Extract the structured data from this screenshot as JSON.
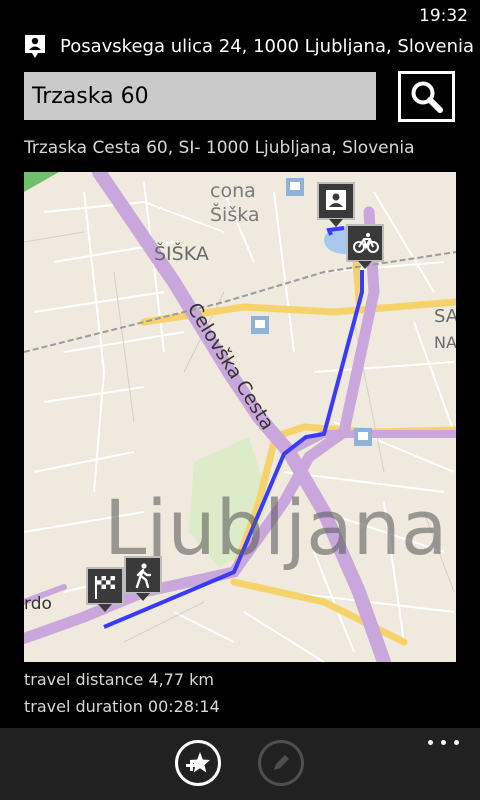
{
  "status_bar": {
    "time": "19:32"
  },
  "location": {
    "icon": "person-pin-icon",
    "text": "Posavskega ulica 24, 1000 Ljubljana, Slovenia"
  },
  "search": {
    "value": "Trzaska 60",
    "button_icon": "search-icon"
  },
  "result": {
    "address": "Trzaska Cesta 60, SI- 1000 Ljubljana, Slovenia"
  },
  "map": {
    "labels": {
      "district_cona_line1": "cona",
      "district_cona_line2": "Šiška",
      "district_siska": "ŠIŠKA",
      "street_celovska": "Celovška Cesta",
      "city": "Ljubljana",
      "edge_right_1": "SA",
      "edge_right_2": "NA",
      "edge_left": "rdo"
    },
    "pins": {
      "start_icon": "person-pin-icon",
      "bike_icon": "bicycle-icon",
      "walk_icon": "walking-icon",
      "finish_icon": "checkered-flag-icon"
    },
    "route_color": "#3a3aff"
  },
  "trip": {
    "distance": "travel distance 4,77 km",
    "duration": "travel duration 00:28:14"
  },
  "app_bar": {
    "favorite_icon": "add-favorite-icon",
    "edit_icon": "pencil-icon",
    "more_icon": "more-dots-icon"
  }
}
